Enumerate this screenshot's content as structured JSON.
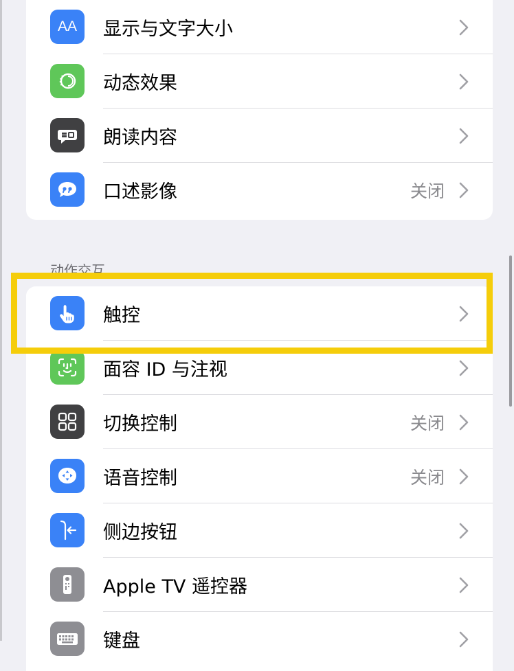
{
  "vision_rows": [
    {
      "label": "显示与文字大小",
      "value": "",
      "icon": "text-size-icon",
      "color": "#3a82f7"
    },
    {
      "label": "动态效果",
      "value": "",
      "icon": "motion-icon",
      "color": "#5fc759"
    },
    {
      "label": "朗读内容",
      "value": "",
      "icon": "spoken-content-icon",
      "color": "#404042"
    },
    {
      "label": "口述影像",
      "value": "关闭",
      "icon": "audio-description-icon",
      "color": "#3a82f7"
    }
  ],
  "motor_section": {
    "header": "动作交互",
    "rows": [
      {
        "label": "触控",
        "value": "",
        "icon": "touch-hand-icon",
        "color": "#3a82f7"
      },
      {
        "label": "面容 ID 与注视",
        "value": "",
        "icon": "face-id-icon",
        "color": "#5fc759"
      },
      {
        "label": "切换控制",
        "value": "关闭",
        "icon": "switch-control-icon",
        "color": "#404042"
      },
      {
        "label": "语音控制",
        "value": "关闭",
        "icon": "voice-control-icon",
        "color": "#3a82f7"
      },
      {
        "label": "侧边按钮",
        "value": "",
        "icon": "side-button-icon",
        "color": "#3a82f7"
      },
      {
        "label": "Apple TV 遥控器",
        "value": "",
        "icon": "apple-tv-remote-icon",
        "color": "#8e8e93"
      },
      {
        "label": "键盘",
        "value": "",
        "icon": "keyboard-icon",
        "color": "#8e8e93"
      }
    ]
  },
  "text_size_icon_glyph": "AA",
  "highlight_color": "#f5cd0a"
}
